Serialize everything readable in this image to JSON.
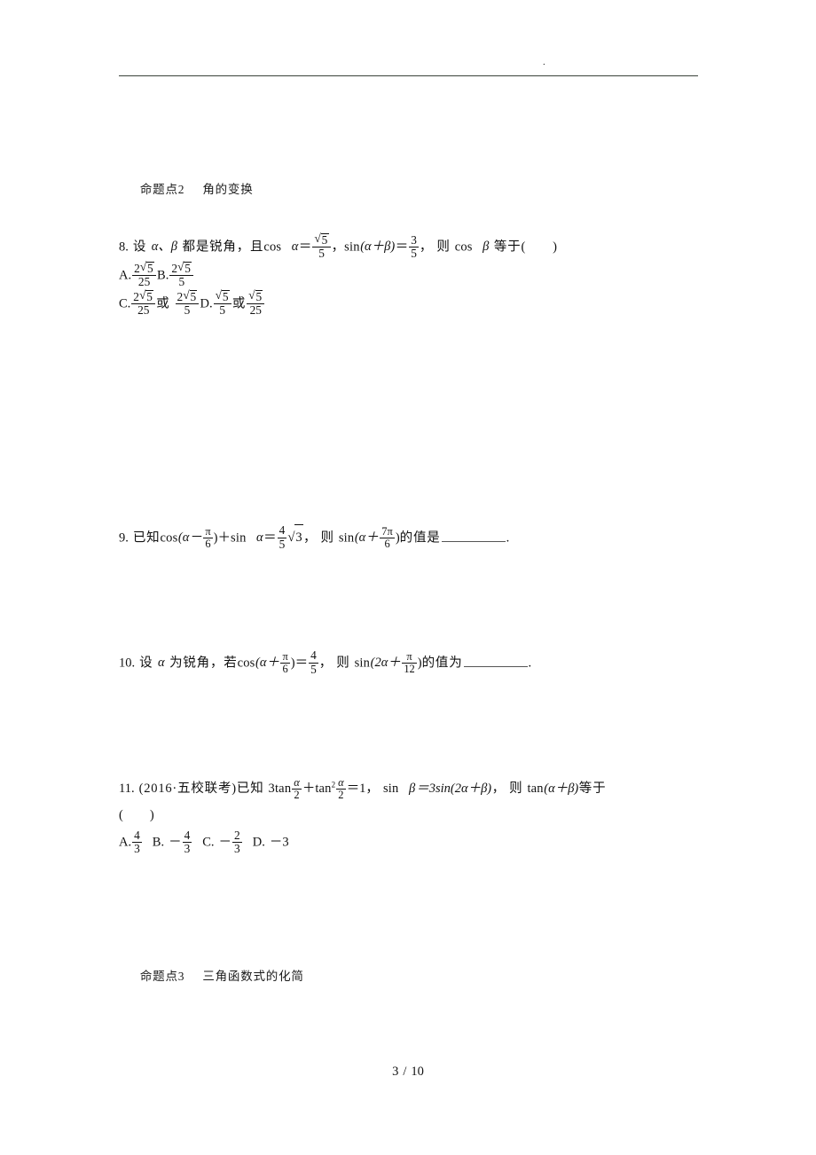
{
  "header": {
    "mark": ".",
    "rule_color": "#3a423a"
  },
  "sections": [
    {
      "id": "section-2",
      "label": "命题点2",
      "title": "角的变换"
    },
    {
      "id": "section-3",
      "label": "命题点3",
      "title": "三角函数式的化简"
    }
  ],
  "problems": [
    {
      "number": "8.",
      "type": "multiple-choice",
      "stem_parts": {
        "lead": "设",
        "vars": "α、β",
        "condition": "都是锐角，且",
        "fn_cos": "cos",
        "alpha": "α",
        "eq1": "＝",
        "val1_num": "√5",
        "val1_den": "5",
        "comma": "，",
        "fn_sin": "sin",
        "arg": "(α＋β)",
        "eq2": "＝",
        "val2_num": "3",
        "val2_den": "5",
        "comma2": "，",
        "then": "则",
        "fn_cos2": "cos",
        "beta": "β",
        "ask": "等于("
      },
      "close_paren": ")",
      "options": [
        {
          "label": "A.",
          "num": "2√5",
          "den": "25"
        },
        {
          "label": "B.",
          "num": "2√5",
          "den": "5"
        },
        {
          "label": "C.",
          "num1": "2√5",
          "den1": "25",
          "conj": "或",
          "num2": "2√5",
          "den2": "5"
        },
        {
          "label": "D.",
          "num1": "√5",
          "den1": "5",
          "conj": "或",
          "num2": "√5",
          "den2": "25"
        }
      ]
    },
    {
      "number": "9.",
      "type": "fill-in-blank",
      "known": "已知",
      "fn1": "cos",
      "expr1_open": "(α－",
      "f1_num": "π",
      "f1_den": "6",
      "expr1_close": ")",
      "plus": "＋",
      "fn2": "sin",
      "alpha": "α",
      "eq": "＝",
      "f2_num": "4",
      "f2_den": "5",
      "radical": "√3",
      "comma": "，",
      "then": "则",
      "fn3": "sin",
      "expr2_open": "(α＋",
      "f3_num": "7π",
      "f3_den": "6",
      "expr2_close": ")",
      "tail": "的值是",
      "period": "."
    },
    {
      "number": "10.",
      "type": "fill-in-blank",
      "lead": "设",
      "alpha": "α",
      "cond": "为锐角，若",
      "fn1": "cos",
      "expr1_open": "(α＋",
      "f1_num": "π",
      "f1_den": "6",
      "expr1_close": ")",
      "eq": "＝",
      "f2_num": "4",
      "f2_den": "5",
      "comma": "，",
      "then": "则",
      "fn2": "sin",
      "expr2_open": "(2α＋",
      "f3_num": "π",
      "f3_den": "12",
      "expr2_close": ")",
      "tail": "的值为",
      "period": "."
    },
    {
      "number": "11.",
      "type": "multiple-choice",
      "source": "(2016·五校联考)",
      "known": "已知",
      "term1_fn": "3tan",
      "t1_num": "α",
      "t1_den": "2",
      "plus": "＋",
      "term2_fn": "tan",
      "term2_pow": "2",
      "t2_num": "α",
      "t2_den": "2",
      "eq1": "＝1，",
      "fn_sin": "sin",
      "beta": "β",
      "eq2": "＝3sin(2α＋β)",
      "comma": "，",
      "then": "则",
      "fn_tan": "tan",
      "arg": "(α＋β)",
      "ask": "等于",
      "paren_line": "(",
      "paren_close": ")",
      "options": [
        {
          "label": "A.",
          "sign": "",
          "num": "4",
          "den": "3"
        },
        {
          "label": "B.",
          "sign": "－",
          "num": "4",
          "den": "3"
        },
        {
          "label": "C.",
          "sign": "－",
          "num": "2",
          "den": "3"
        },
        {
          "label": "D.",
          "sign": "－3",
          "num": "",
          "den": ""
        }
      ]
    }
  ],
  "footer": {
    "page_current": "3",
    "page_separator": "/",
    "page_total": "10"
  }
}
